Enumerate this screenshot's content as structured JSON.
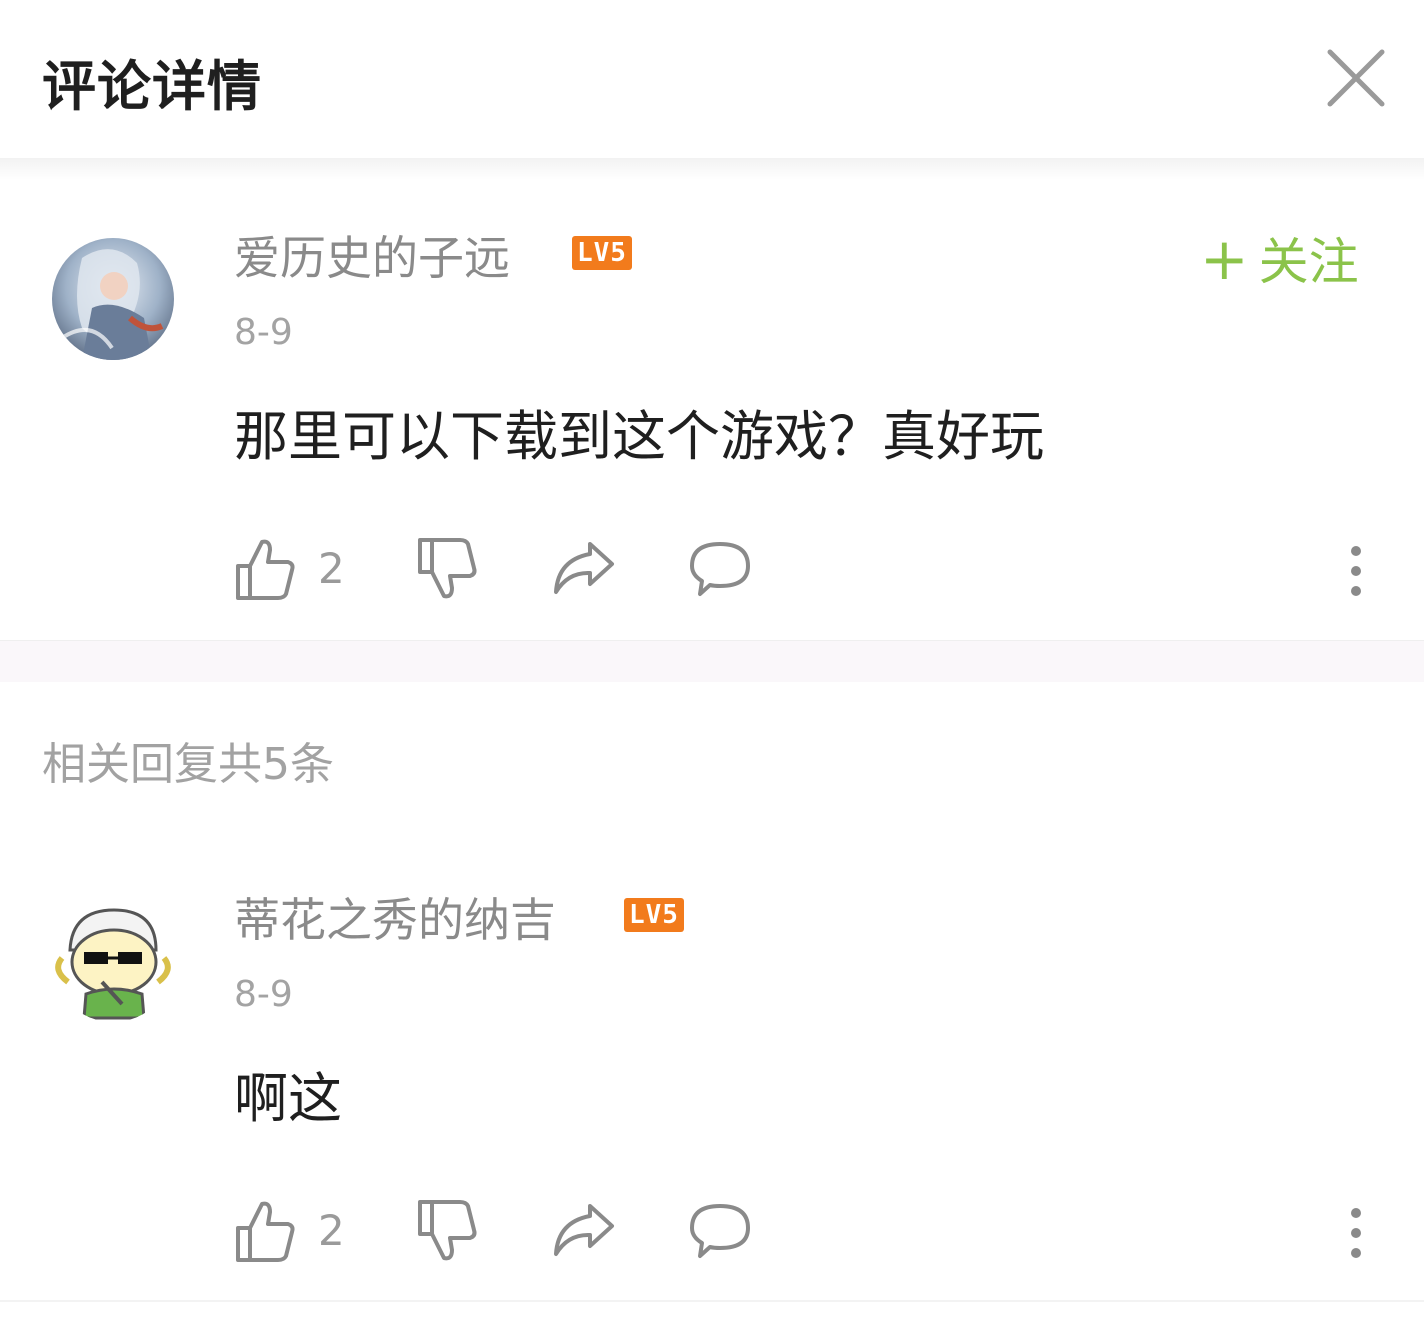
{
  "header": {
    "title": "评论详情",
    "close_icon": "close-icon"
  },
  "main_comment": {
    "username": "爱历史的子远",
    "level": "LV5",
    "date": "8-9",
    "content": "那里可以下载到这个游戏？真好玩",
    "follow_label": "关注",
    "follow_plus": "+",
    "likes": "2"
  },
  "replies": {
    "title": "相关回复共5条",
    "items": [
      {
        "username": "蒂花之秀的纳吉",
        "level": "LV5",
        "date": "8-9",
        "content": "啊这",
        "likes": "2"
      }
    ]
  },
  "colors": {
    "accent_green": "#8bc34a",
    "level_badge": "#f27b1c"
  }
}
